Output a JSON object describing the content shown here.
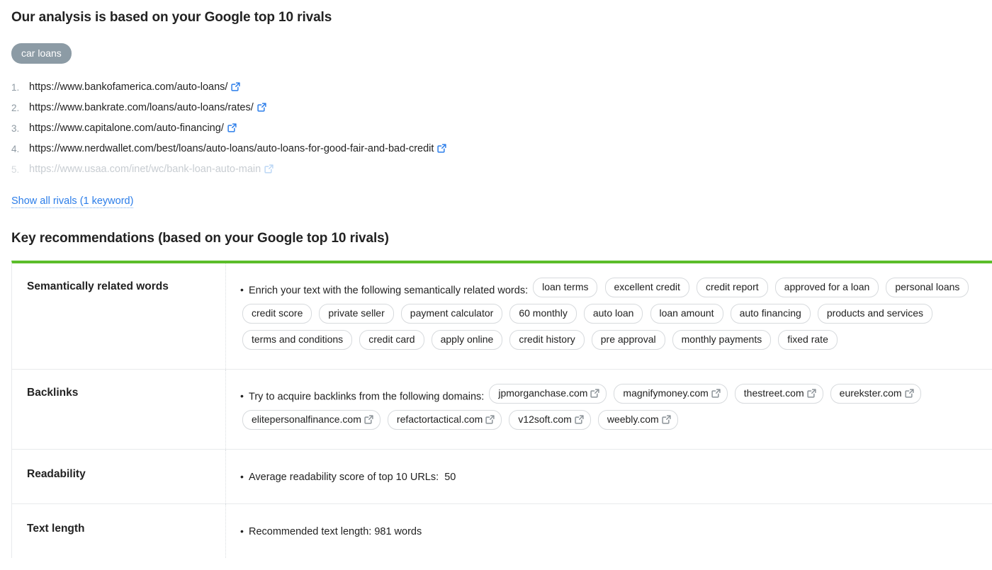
{
  "rivals": {
    "title": "Our analysis is based on your Google top 10 rivals",
    "keyword_badge": "car loans",
    "items": [
      {
        "url": "https://www.bankofamerica.com/auto-loans/",
        "icon": "external-link-icon",
        "faded": false
      },
      {
        "url": "https://www.bankrate.com/loans/auto-loans/rates/",
        "icon": "external-link-icon",
        "faded": false
      },
      {
        "url": "https://www.capitalone.com/auto-financing/",
        "icon": "external-link-icon",
        "faded": false
      },
      {
        "url": "https://www.nerdwallet.com/best/loans/auto-loans/auto-loans-for-good-fair-and-bad-credit",
        "icon": "external-link-icon",
        "faded": false
      },
      {
        "url": "https://www.usaa.com/inet/wc/bank-loan-auto-main",
        "icon": "external-link-icon",
        "faded": true
      }
    ],
    "show_all_link": "Show all rivals (1 keyword)"
  },
  "recommendations": {
    "title": "Key recommendations (based on your Google top 10 rivals)",
    "accent_color": "#5bbd2a",
    "rows": [
      {
        "label": "Semantically related words",
        "bullet": "Enrich your text with the following semantically related words:",
        "chips": [
          "loan terms",
          "excellent credit",
          "credit report",
          "approved for a loan",
          "personal loans",
          "credit score",
          "private seller",
          "payment calculator",
          "60 monthly",
          "auto loan",
          "loan amount",
          "auto financing",
          "products and services",
          "terms and conditions",
          "credit card",
          "apply online",
          "credit history",
          "pre approval",
          "monthly payments",
          "fixed rate"
        ]
      },
      {
        "label": "Backlinks",
        "bullet": "Try to acquire backlinks from the following domains:",
        "chips": [
          "jpmorganchase.com",
          "magnifymoney.com",
          "thestreet.com",
          "eurekster.com",
          "elitepersonalfinance.com",
          "refactortactical.com",
          "v12soft.com",
          "weebly.com"
        ],
        "chip_icon": "external-link-icon"
      },
      {
        "label": "Readability",
        "bullet": "Average readability score of top 10 URLs:",
        "value": "50"
      },
      {
        "label": "Text length",
        "bullet": "Recommended text length: 981 words"
      }
    ]
  }
}
